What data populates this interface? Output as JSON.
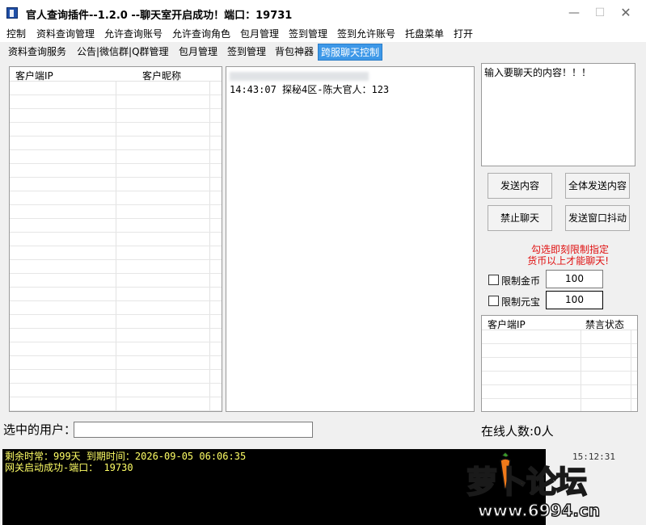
{
  "window": {
    "title": "官人查询插件--1.2.0 --聊天室开启成功！端口：19731",
    "min_glyph": "—",
    "max_glyph": "☐",
    "close_glyph": "✕"
  },
  "menu": [
    "控制",
    "资料查询管理",
    "允许查询账号",
    "允许查询角色",
    "包月管理",
    "签到管理",
    "签到允许账号",
    "托盘菜单",
    "打开"
  ],
  "tabs": [
    "资料查询服务",
    "公告|微信群|Q群管理",
    "包月管理",
    "签到管理",
    "背包神器",
    "跨服聊天控制"
  ],
  "active_tab": "跨服聊天控制",
  "client_list": {
    "col_ip": "客户端IP",
    "col_nick": "客户昵称"
  },
  "chat_log": {
    "lines": [
      "14:43:07 探秘4区-陈大官人：123"
    ]
  },
  "message_box": {
    "value": "输入要聊天的内容！！！"
  },
  "buttons": {
    "send": "发送内容",
    "send_all": "全体发送内容",
    "ban_chat": "禁止聊天",
    "shake": "发送窗口抖动"
  },
  "warning": {
    "line1": "勾选即刻限制指定",
    "line2": "货币以上才能聊天!"
  },
  "limits": {
    "gold_label": "限制金币",
    "gold_value": "100",
    "yuanbao_label": "限制元宝",
    "yuanbao_value": "100"
  },
  "ban_list": {
    "col_ip": "客户端IP",
    "col_status": "禁言状态"
  },
  "selected_user": {
    "label": "选中的用户：",
    "value": ""
  },
  "online": {
    "label": "在线人数:0人"
  },
  "console": {
    "lines": [
      "剩余时常：999天 到期时间：2026-09-05 06:06:35",
      "网关启动成功-端口： 19730"
    ]
  },
  "clock": "15:12:31",
  "watermark": {
    "main": "萝卜论坛",
    "url": "www.6994.cn"
  },
  "colors": {
    "active_tab": "#3d98e8",
    "warning": "#e01010",
    "console_text": "#ffff66",
    "console_bg": "#000000"
  }
}
